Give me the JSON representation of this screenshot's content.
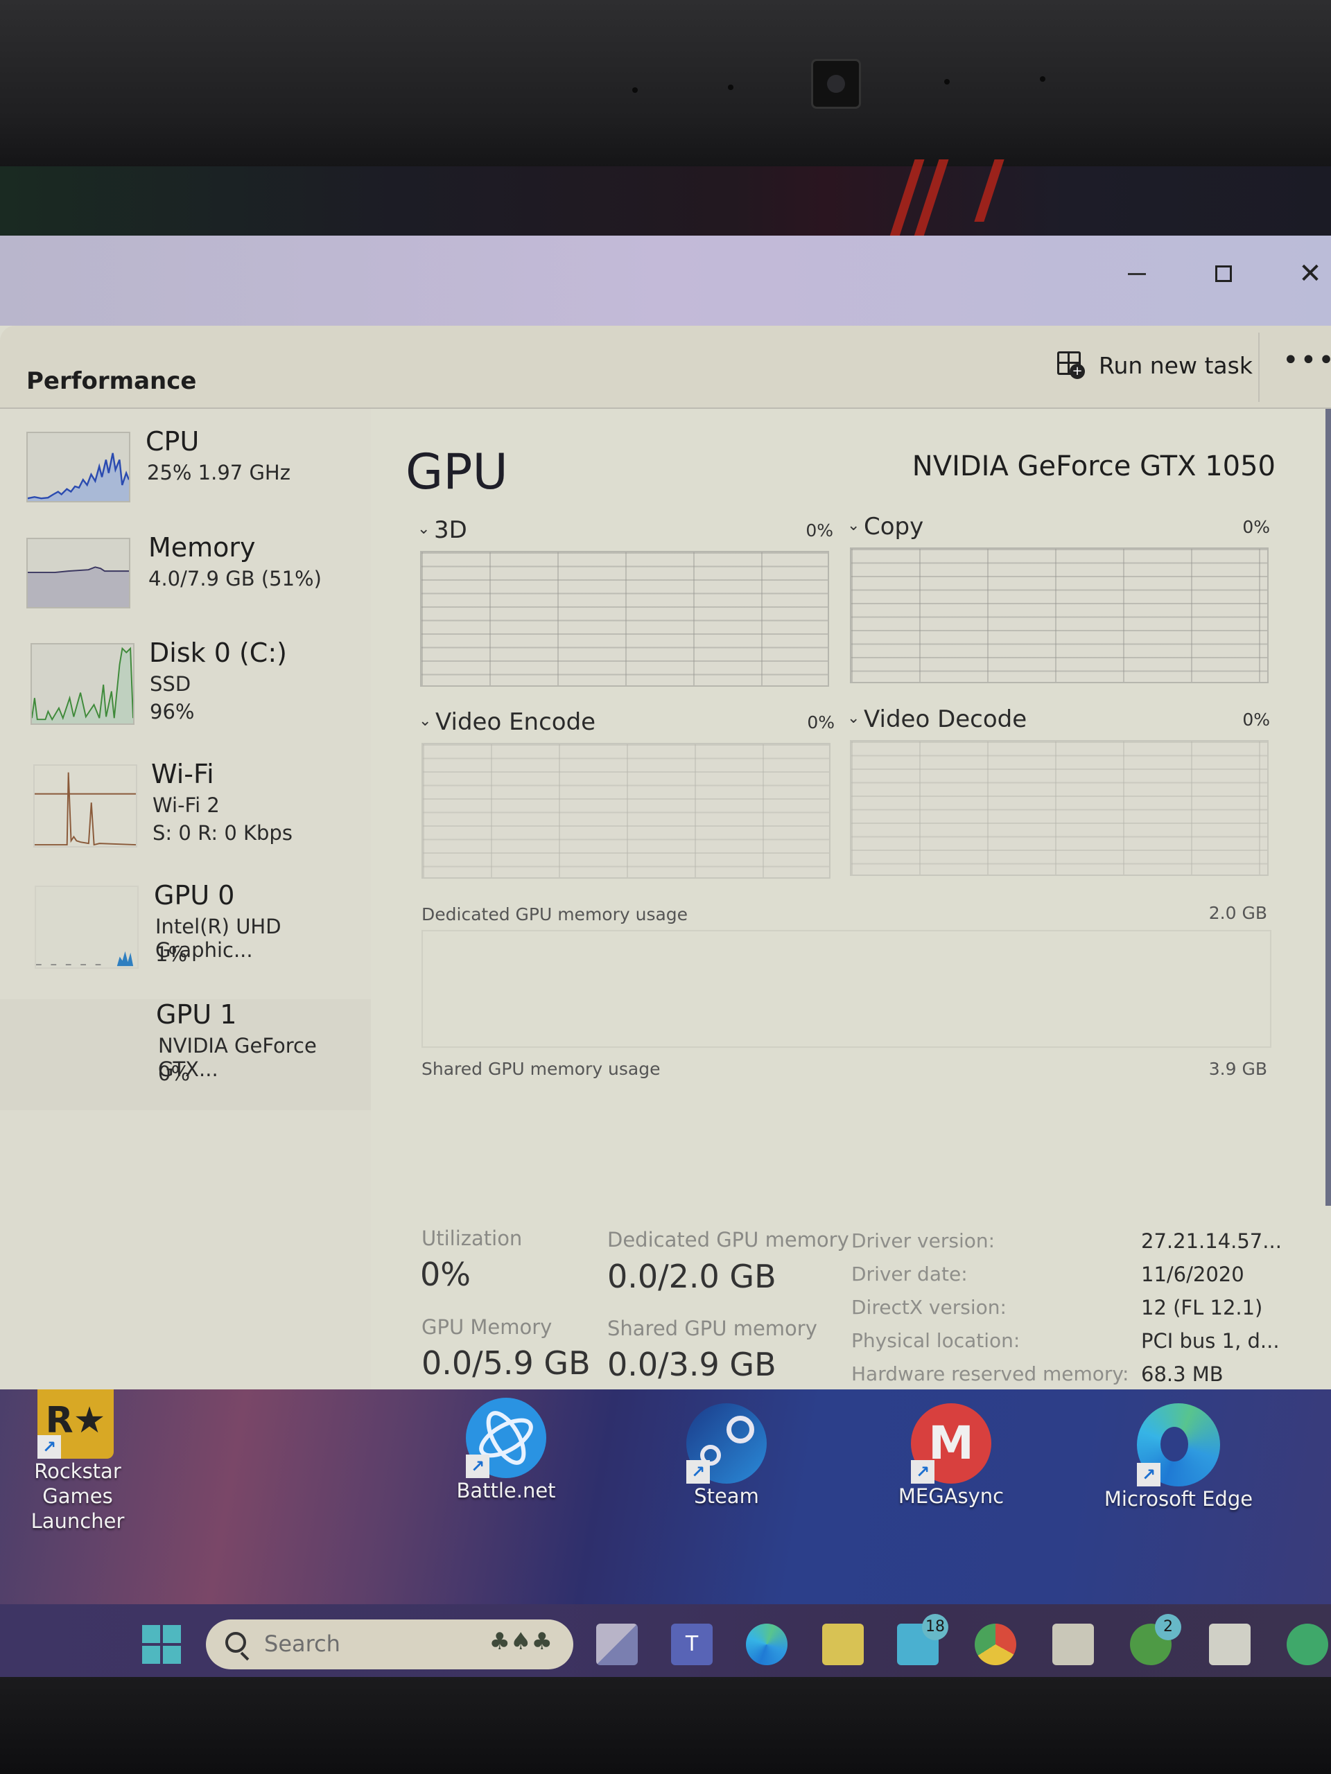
{
  "window": {
    "title_buttons": {
      "minimize": "minimize",
      "maximize": "maximize",
      "close": "close"
    },
    "page_title": "Performance",
    "run_new_task_label": "Run new task",
    "more_label": "•••"
  },
  "sidebar": {
    "items": [
      {
        "title": "CPU",
        "line1": "25%  1.97 GHz",
        "line2": "",
        "graph_color": "#2b4bb0"
      },
      {
        "title": "Memory",
        "line1": "4.0/7.9 GB (51%)",
        "line2": "",
        "graph_color": "#6a5aa8"
      },
      {
        "title": "Disk 0 (C:)",
        "line1": "SSD",
        "line2": "96%",
        "graph_color": "#3f8a3a"
      },
      {
        "title": "Wi-Fi",
        "line1": "Wi-Fi 2",
        "line2": "S: 0 R: 0 Kbps",
        "graph_color": "#8a5a3a"
      },
      {
        "title": "GPU 0",
        "line1": "Intel(R) UHD Graphic...",
        "line2": "1%",
        "graph_color": "#2f7fc0"
      },
      {
        "title": "GPU 1",
        "line1": "NVIDIA GeForce GTX...",
        "line2": "0%",
        "graph_color": "#2f7fc0"
      }
    ]
  },
  "main": {
    "title": "GPU",
    "device_name": "NVIDIA GeForce GTX 1050",
    "engines": [
      {
        "label": "3D",
        "percent": "0%"
      },
      {
        "label": "Copy",
        "percent": "0%"
      },
      {
        "label": "Video Encode",
        "percent": "0%"
      },
      {
        "label": "Video Decode",
        "percent": "0%"
      }
    ],
    "dedicated_usage": {
      "label": "Dedicated GPU memory usage",
      "max": "2.0 GB"
    },
    "shared_usage": {
      "label": "Shared GPU memory usage",
      "max": "3.9 GB"
    },
    "stats": {
      "utilization_label": "Utilization",
      "utilization_value": "0%",
      "dedicated_label": "Dedicated GPU memory",
      "dedicated_value": "0.0/2.0 GB",
      "gpu_memory_label": "GPU Memory",
      "gpu_memory_value": "0.0/5.9 GB",
      "shared_label": "Shared GPU memory",
      "shared_value": "0.0/3.9 GB"
    },
    "properties": [
      {
        "label": "Driver version:",
        "value": "27.21.14.57..."
      },
      {
        "label": "Driver date:",
        "value": "11/6/2020"
      },
      {
        "label": "DirectX version:",
        "value": "12 (FL 12.1)"
      },
      {
        "label": "Physical location:",
        "value": "PCI bus 1, d..."
      },
      {
        "label": "Hardware reserved memory:",
        "value": "68.3 MB"
      }
    ]
  },
  "desktop": {
    "icons": [
      {
        "label_line1": "Rockstar Games",
        "label_line2": "Launcher",
        "glyph": "R★"
      },
      {
        "label_line1": "Battle.net",
        "label_line2": "",
        "glyph": ""
      },
      {
        "label_line1": "Steam",
        "label_line2": "",
        "glyph": ""
      },
      {
        "label_line1": "MEGAsync",
        "label_line2": "",
        "glyph": "M"
      },
      {
        "label_line1": "Microsoft Edge",
        "label_line2": "",
        "glyph": ""
      }
    ]
  },
  "taskbar": {
    "search_placeholder": "Search",
    "search_decoration": "♣♠♣",
    "mail_badge": "18",
    "xbox_badge": "2",
    "apps": [
      "task-view",
      "teams",
      "edge",
      "file-explorer",
      "mail",
      "chrome",
      "microsoft-store",
      "xbox",
      "minecraft",
      "spotify"
    ]
  }
}
